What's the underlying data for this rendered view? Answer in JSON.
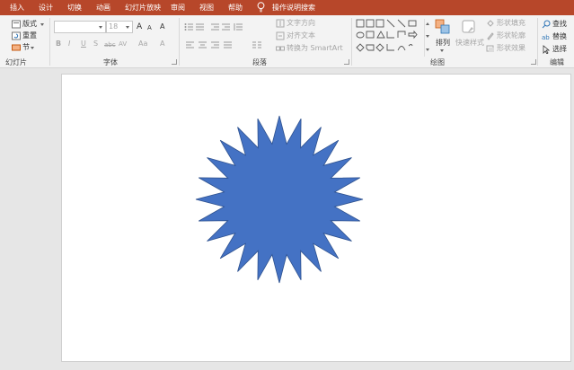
{
  "tabs": [
    "插入",
    "设计",
    "切换",
    "动画",
    "幻灯片放映",
    "审阅",
    "视图",
    "帮助"
  ],
  "tell_me": "操作说明搜索",
  "ribbon": {
    "slides_group": {
      "label": "幻灯片",
      "layout": "版式",
      "reset": "重置",
      "section": "节"
    },
    "font_group": {
      "label": "字体",
      "font_name": "",
      "font_size": "18",
      "grow": "A",
      "shrink": "A",
      "clear": "A",
      "bold": "B",
      "italic": "I",
      "underline": "U",
      "shadow": "S",
      "strike": "abc",
      "spacing": "AV",
      "case": "Aa",
      "color": "A"
    },
    "paragraph_group": {
      "label": "段落",
      "text_direction": "文字方向",
      "align_text": "对齐文本",
      "smartart": "转换为 SmartArt"
    },
    "drawing_group": {
      "label": "绘图",
      "arrange": "排列",
      "quick_styles": "快速样式",
      "fill": "形状填充",
      "outline": "形状轮廓",
      "effects": "形状效果"
    },
    "editing_group": {
      "label": "编辑",
      "find": "查找",
      "replace": "替换",
      "select": "选择"
    }
  },
  "shape": {
    "type": "24-point star",
    "fill": "#4472c4",
    "points": 24
  },
  "colors": {
    "tab_bar": "#b7472a",
    "ribbon": "#f3f3f3",
    "workspace": "#e6e6e6",
    "slide": "#ffffff"
  }
}
